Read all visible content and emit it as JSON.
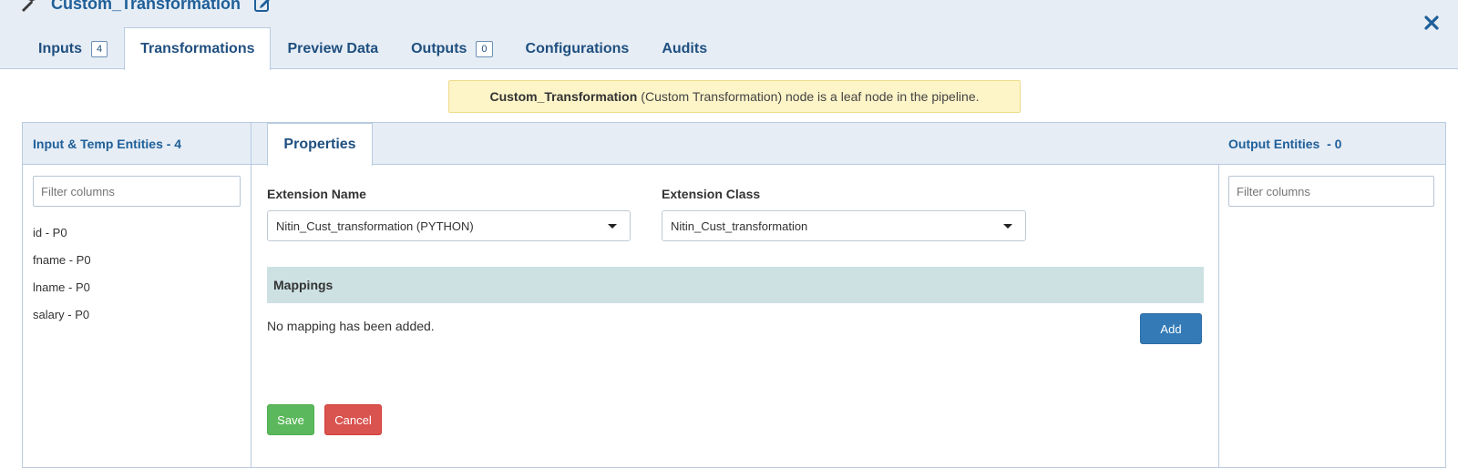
{
  "window": {
    "title": "Custom_Transformation",
    "close_icon": "close-icon"
  },
  "tabs": [
    {
      "label": "Inputs",
      "badge": "4"
    },
    {
      "label": "Transformations"
    },
    {
      "label": "Preview Data"
    },
    {
      "label": "Outputs",
      "badge": "0"
    },
    {
      "label": "Configurations"
    },
    {
      "label": "Audits"
    }
  ],
  "notice": {
    "node_name": "Custom_Transformation",
    "text": "(Custom Transformation) node is a leaf node in the pipeline."
  },
  "left_panel": {
    "title": "Input & Temp Entities - 4",
    "filter_placeholder": "Filter columns",
    "items": [
      "id - P0",
      "fname - P0",
      "lname - P0",
      "salary - P0"
    ]
  },
  "middle_panel": {
    "tab": "Properties",
    "extension_name_label": "Extension Name",
    "extension_name_value": "Nitin_Cust_transformation (PYTHON)",
    "extension_class_label": "Extension Class",
    "extension_class_value": "Nitin_Cust_transformation",
    "mappings_title": "Mappings",
    "no_mapping_text": "No mapping has been added.",
    "add_label": "Add",
    "save_label": "Save",
    "cancel_label": "Cancel"
  },
  "right_panel": {
    "title": "Output Entities  - 0",
    "filter_placeholder": "Filter columns"
  },
  "colors": {
    "header_bg": "#e6edf5",
    "accent_text": "#1f5f99",
    "notice_bg": "#fdf4c8",
    "mappings_bg": "#cde1e3",
    "add_button": "#337ab7",
    "save_button": "#5cb85c",
    "cancel_button": "#d9534f"
  }
}
